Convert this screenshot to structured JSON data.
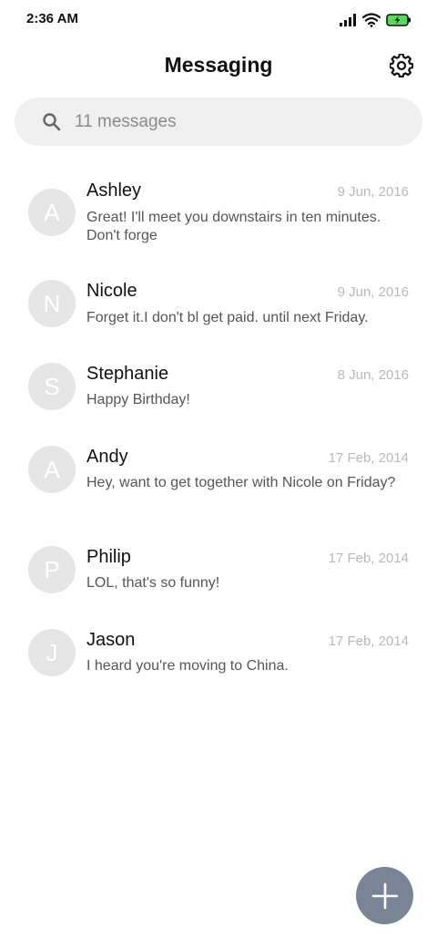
{
  "status_bar": {
    "time": "2:36 AM",
    "icons": [
      "signal-icon",
      "wifi-icon",
      "battery-charging-icon"
    ],
    "battery_color": "#5cd65c"
  },
  "header": {
    "title": "Messaging",
    "settings_icon": "gear-icon"
  },
  "search": {
    "placeholder": "11 messages",
    "icon": "search-icon"
  },
  "conversations": [
    {
      "initial": "A",
      "name": "Ashley",
      "date": "9 Jun, 2016",
      "snippet": "Great! I'll meet you downstairs in ten minutes. Don't forge"
    },
    {
      "initial": "N",
      "name": "Nicole",
      "date": "9 Jun, 2016",
      "snippet": "Forget it.I don't bl get paid. until next Friday."
    },
    {
      "initial": "S",
      "name": "Stephanie",
      "date": "8 Jun, 2016",
      "snippet": "Happy Birthday!"
    },
    {
      "initial": "A",
      "name": "Andy",
      "date": "17 Feb, 2014",
      "snippet": "Hey, want to get together with Nicole on Friday?"
    },
    {
      "initial": "P",
      "name": "Philip",
      "date": "17 Feb, 2014",
      "snippet": "LOL, that's so funny!"
    },
    {
      "initial": "J",
      "name": "Jason",
      "date": "17 Feb, 2014",
      "snippet": "I heard you're moving to China."
    }
  ],
  "fab": {
    "icon": "plus-icon",
    "color": "#7a8497"
  }
}
